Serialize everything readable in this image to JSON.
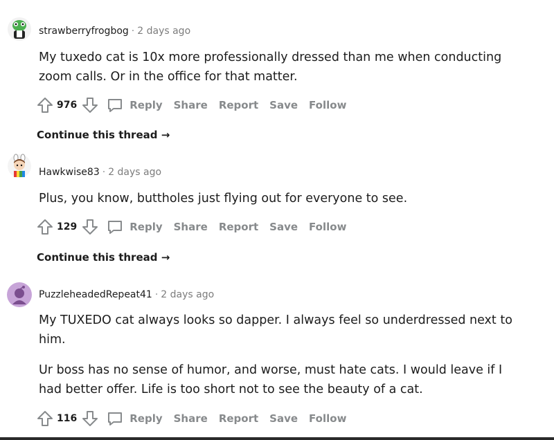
{
  "comments": [
    {
      "author": "strawberryfrogbog",
      "time": "2 days ago",
      "paragraphs": [
        "My tuxedo cat is 10x more professionally dressed than me when conducting zoom calls. Or in the office for that matter."
      ],
      "score": "976",
      "actions": {
        "reply": "Reply",
        "share": "Share",
        "report": "Report",
        "save": "Save",
        "follow": "Follow"
      },
      "continue": "Continue this thread",
      "avatar_color": "#4caf50"
    },
    {
      "author": "Hawkwise83",
      "time": "2 days ago",
      "paragraphs": [
        "Plus, you know, buttholes just flying out for everyone to see."
      ],
      "score": "129",
      "actions": {
        "reply": "Reply",
        "share": "Share",
        "report": "Report",
        "save": "Save",
        "follow": "Follow"
      },
      "continue": "Continue this thread",
      "avatar_color": "#7a4a2a"
    },
    {
      "author": "PuzzleheadedRepeat41",
      "time": "2 days ago",
      "paragraphs": [
        "My TUXEDO cat always looks so dapper. I always feel so underdressed next to him.",
        "Ur boss has no sense of humor, and worse, must hate cats. I would leave if I had better offer. Life is too short not to see the beauty of a cat."
      ],
      "score": "116",
      "actions": {
        "reply": "Reply",
        "share": "Share",
        "report": "Report",
        "save": "Save",
        "follow": "Follow"
      },
      "avatar_color": "#c7a4d8"
    }
  ],
  "separator": "·",
  "arrow": "→",
  "icons": {
    "upvote": "upvote-icon",
    "downvote": "downvote-icon",
    "comment": "comment-bubble-icon"
  }
}
